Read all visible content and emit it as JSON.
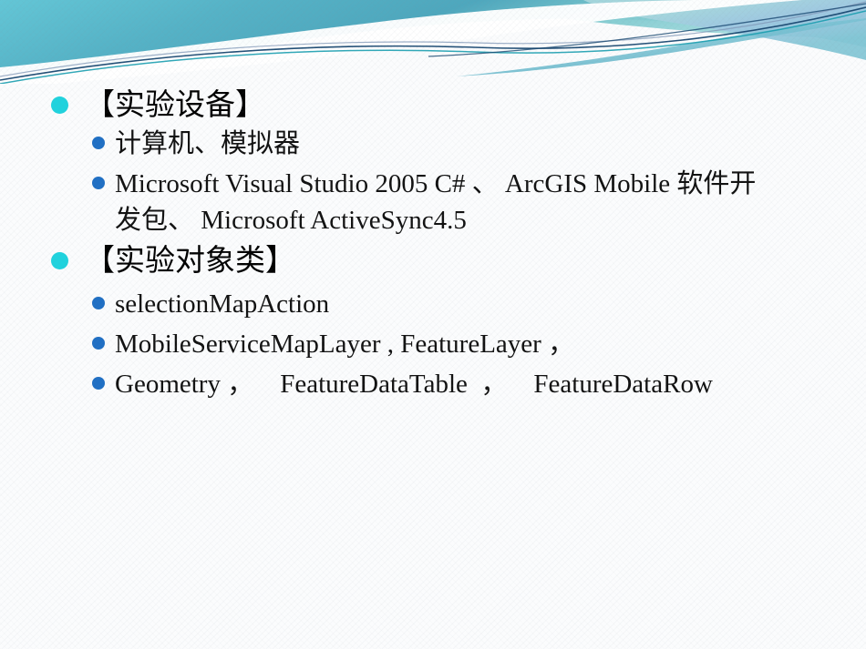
{
  "slide": {
    "background_color": "#fbfcfd",
    "header": {
      "name": "decorative-wave-banner",
      "colors": {
        "teal_dark": "#3f9fb5",
        "teal_mid": "#62c3d2",
        "teal_light": "#a9dfe2",
        "blue_haze": "#9fc4e4",
        "line_navy": "#16466f",
        "line_teal": "#199fb0",
        "line_steel": "#7e95b5"
      }
    },
    "bullet_colors": {
      "level1": "#1fd3de",
      "level2": "#1f6fc4"
    },
    "blocks": [
      {
        "level": 1,
        "name": "heading-lab-equipment",
        "text": "【实验设备】"
      },
      {
        "level": 2,
        "name": "item-computer-simulator",
        "text": "计算机、模拟器"
      },
      {
        "level": 2,
        "name": "item-software-toolchain",
        "line1": "Microsoft Visual Studio 2005 C# 、 ArcGIS Mobile 软件开",
        "line2": "发包、 Microsoft ActiveSync4.5"
      },
      {
        "level": 1,
        "name": "heading-lab-object-classes",
        "text": "【实验对象类】"
      },
      {
        "level": 2,
        "name": "item-selection-map-action",
        "text": "selectionMapAction"
      },
      {
        "level": 2,
        "name": "item-map-layer-classes",
        "text": "MobileServiceMapLayer , FeatureLayer ，"
      },
      {
        "level": 2,
        "name": "item-geometry-classes",
        "text": "Geometry ，    FeatureDataTable  ，    FeatureDataRow"
      }
    ]
  }
}
